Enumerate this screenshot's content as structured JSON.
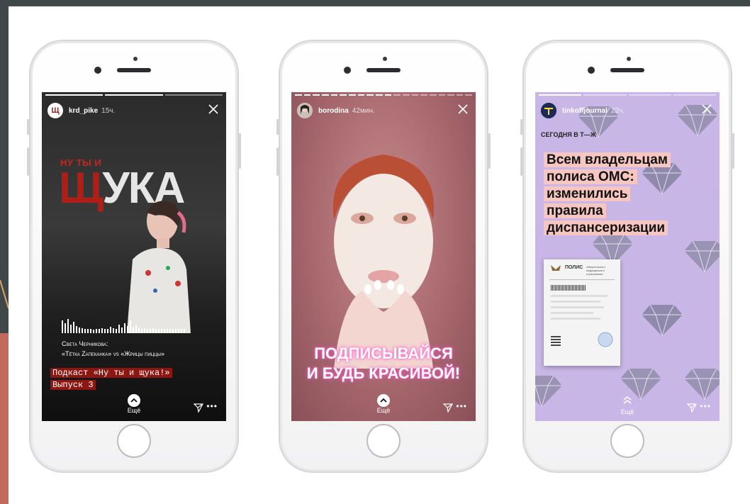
{
  "colors": {
    "accent_red": "#b01e18",
    "pink_highlight": "#f7c6c0",
    "lavender": "#c7b6e6"
  },
  "stories": [
    {
      "username": "krd_pike",
      "time": "15ч.",
      "avatar_letter": "Щ",
      "kicker": "НУ ТЫ И",
      "title_red": "Щ",
      "title_rest": "УКА",
      "guest_name": "Света Черникова:",
      "guest_line": "«Тётка Zапеканка» vs «Жрицы пиццы»",
      "podcast_line1": "Подкаст «Ну ты и щука!»",
      "podcast_line2": "Выпуск 3",
      "more_label": "Ещё"
    },
    {
      "username": "borodina",
      "time": "42мин.",
      "cta_line1": "ПОДПИСЫВАЙСЯ",
      "cta_line2": "И БУДЬ КРАСИВОЙ!",
      "more_label": "Ещё"
    },
    {
      "username": "tinkoffjournal",
      "time": "22ч.",
      "kicker": "СЕГОДНЯ В Т—Ж",
      "headline": [
        "Всем владельцам",
        "полиса ОМС:",
        "изменились",
        "правила",
        "диспансеризации"
      ],
      "doc_title": "ПОЛИС",
      "doc_subtitle": "обязательного медицинского страхования",
      "more_label": "Ещё"
    }
  ]
}
